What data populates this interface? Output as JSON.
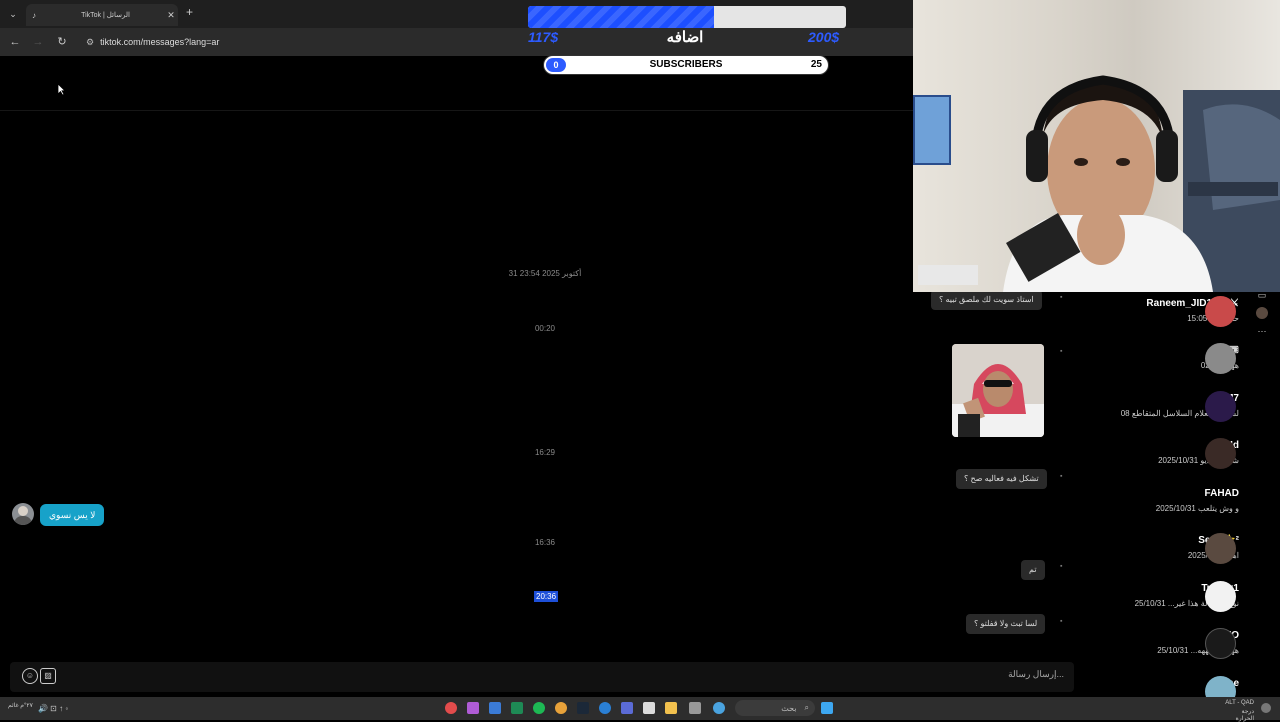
{
  "browser": {
    "tab_title": "TikTok | الرسائل",
    "tab_icon": "tiktok-icon",
    "url": "tiktok.com/messages?lang=ar",
    "new_tab": "+",
    "close_tab": "✕"
  },
  "overlay": {
    "goal_left": "117$",
    "goal_title": "اضافه",
    "goal_right": "200$",
    "goal_progress": 0.585,
    "subs_current": "0",
    "subs_label": "SUBSCRIBERS",
    "subs_goal": "25"
  },
  "chat": {
    "timestamps": [
      "31 أكتوبر 2025 23:54",
      "00:20",
      "16:29",
      "16:36",
      "20:36"
    ],
    "outgoing_message": "لا يس نسوي",
    "incoming": [
      "استاذ سويت لك ملصق تبيه ؟",
      "تشكل فيه فعاليه صح ؟",
      "تم",
      "لسا تبث ولا قفلتو ؟"
    ],
    "composer_placeholder": "إرسال رسالة..."
  },
  "conversations": [
    {
      "name": "Raneem_JID1 🎧 ⚔",
      "preview": "15:05 حاط الب"
    },
    {
      "name": "W 🎟",
      "preview": "هههه 02:51"
    },
    {
      "name": "KM7",
      "preview": "لست استعلام السلاسل المتقاطع 08"
    },
    {
      "name": "jUd",
      "preview": "شارك فيديو 2025/10/31"
    },
    {
      "name": "FAHAD",
      "preview": "و وش يتلعب 2025/10/31"
    },
    {
      "name": "Sero ⭐²",
      "preview": "اها 2025/10/31"
    },
    {
      "name": "Turki x1",
      "preview": "نوع الرسالة هذا غير... 25/10/31"
    },
    {
      "name": "FOFO",
      "preview": "25/10/31 ...ههههههههههه"
    },
    {
      "name": "meme",
      "preview": ""
    }
  ],
  "taskbar": {
    "search_label": "بحث",
    "clock_time": "ALT - QAD",
    "clock_date": "درجة الحرارة",
    "left_info": "٢٧°م غائم"
  }
}
